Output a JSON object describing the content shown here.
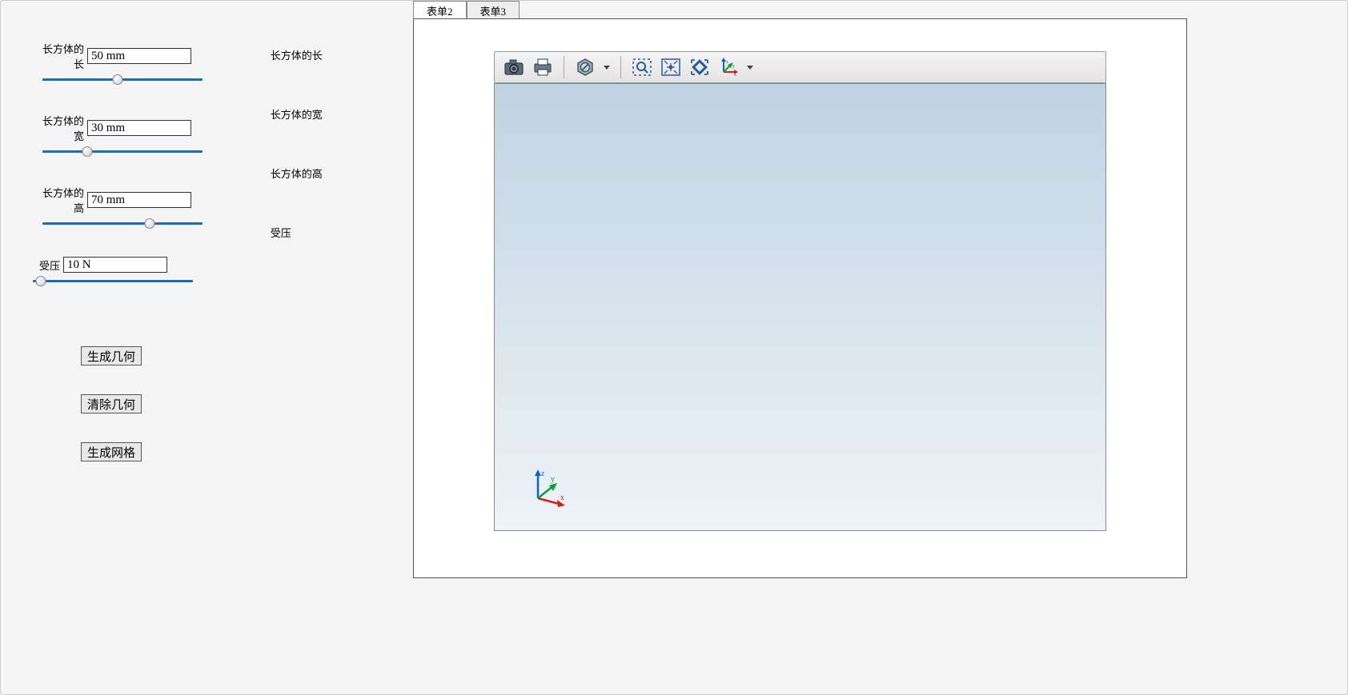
{
  "params": {
    "length": {
      "label": "长方体的长",
      "value": "50 mm",
      "slider_pct": 47
    },
    "width": {
      "label": "长方体的宽",
      "value": "30 mm",
      "slider_pct": 28
    },
    "height": {
      "label": "长方体的高",
      "value": "70 mm",
      "slider_pct": 67
    },
    "pressure": {
      "label": "受压",
      "value": "10 N",
      "slider_pct": 5
    }
  },
  "side_labels": {
    "length": "长方体的长",
    "width": "长方体的宽",
    "height": "长方体的高",
    "pressure": "受压"
  },
  "buttons": {
    "gen_geom": "生成几何",
    "clear_geom": "清除几何",
    "gen_mesh": "生成网格"
  },
  "tabs": [
    {
      "id": "tab2",
      "label": "表单2",
      "active": true
    },
    {
      "id": "tab3",
      "label": "表单3",
      "active": false
    }
  ],
  "toolbar": {
    "snapshot": "snapshot",
    "print": "print",
    "transparency": "transparency",
    "zoom_box": "zoom-box",
    "zoom_extents": "zoom-extents",
    "zoom_selected": "zoom-selected",
    "axes": "axes-view"
  },
  "axis": {
    "x": "x",
    "y": "y",
    "z": "z"
  }
}
